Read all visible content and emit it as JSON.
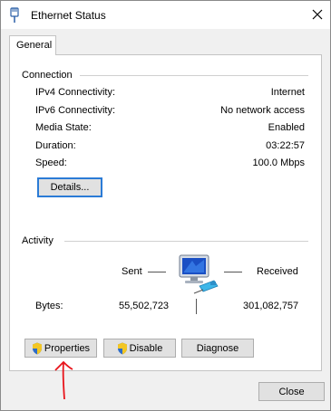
{
  "window": {
    "title": "Ethernet Status",
    "icons": {
      "app": "ethernet-plug-icon",
      "close": "close-icon"
    }
  },
  "tabs": [
    {
      "label": "General",
      "selected": true
    }
  ],
  "connection": {
    "group_label": "Connection",
    "rows": [
      {
        "label": "IPv4 Connectivity:",
        "value": "Internet"
      },
      {
        "label": "IPv6 Connectivity:",
        "value": "No network access"
      },
      {
        "label": "Media State:",
        "value": "Enabled"
      },
      {
        "label": "Duration:",
        "value": "03:22:57"
      },
      {
        "label": "Speed:",
        "value": "100.0 Mbps"
      }
    ],
    "details_button": "Details..."
  },
  "activity": {
    "group_label": "Activity",
    "sent_label": "Sent",
    "received_label": "Received",
    "bytes_label": "Bytes:",
    "bytes_sent": "55,502,723",
    "bytes_received": "301,082,757",
    "icon": "network-computer-icon"
  },
  "buttons": {
    "properties": "Properties",
    "disable": "Disable",
    "diagnose": "Diagnose",
    "close": "Close",
    "shield_icon": "uac-shield-icon"
  },
  "annotation": {
    "icon": "red-arrow-annotation-icon",
    "color": "#e8141b"
  },
  "colors": {
    "accent": "#2b7bd6",
    "window_bg": "#f0f0f0"
  }
}
